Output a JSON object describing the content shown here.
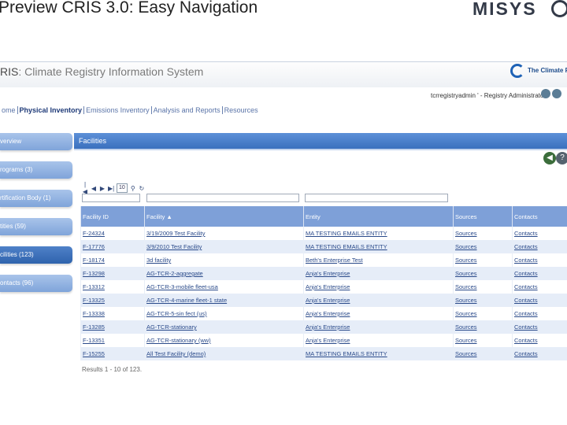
{
  "slide": {
    "title": "Preview CRIS 3.0: Easy Navigation",
    "brand": "MISYS"
  },
  "app": {
    "title_prefix": "RIS",
    "title_rest": ": Climate Registry Information System",
    "org_name": "The Climate Regis",
    "user_line": "tcrregistryadmin ' - Registry Administrator"
  },
  "tabs": [
    {
      "label": "ome"
    },
    {
      "label": "Physical Inventory",
      "active": true
    },
    {
      "label": "Emissions Inventory"
    },
    {
      "label": "Analysis and Reports"
    },
    {
      "label": "Resources"
    }
  ],
  "sidenav": [
    {
      "label": "verview"
    },
    {
      "label": "rograms (3)"
    },
    {
      "label": "rtification Body (1)"
    },
    {
      "label": "tities (59)"
    },
    {
      "label": "cilities (123)",
      "active": true
    },
    {
      "label": "ontacts (96)"
    }
  ],
  "panel": {
    "title": "Facilities"
  },
  "pager": {
    "page_size": "10"
  },
  "grid": {
    "headers": [
      "Facility ID",
      "Facility ▲",
      "Entity",
      "Sources",
      "Contacts"
    ],
    "rows": [
      [
        "F-24324",
        "3/19/2009 Test Facility",
        "MA TESTING EMAILS ENTITY",
        "Sources",
        "Contacts"
      ],
      [
        "F-17776",
        "3/9/2010 Test Facility",
        "MA TESTING EMAILS ENTITY",
        "Sources",
        "Contacts"
      ],
      [
        "F-18174",
        "3d facility",
        "Beth's Enterprise Test",
        "Sources",
        "Contacts"
      ],
      [
        "F-13298",
        "AG-TCR-2-aggregate",
        "Anja's Enterprise",
        "Sources",
        "Contacts"
      ],
      [
        "F-13312",
        "AG-TCR-3-mobile fleet-usa",
        "Anja's Enterprise",
        "Sources",
        "Contacts"
      ],
      [
        "F-13325",
        "AG-TCR-4-marine fleet-1 state",
        "Anja's Enterprise",
        "Sources",
        "Contacts"
      ],
      [
        "F-13338",
        "AG-TCR-5-sin fect (us)",
        "Anja's Enterprise",
        "Sources",
        "Contacts"
      ],
      [
        "F-13285",
        "AG-TCR-stationary",
        "Anja's Enterprise",
        "Sources",
        "Contacts"
      ],
      [
        "F-13351",
        "AG-TCR-stationary (ww)",
        "Anja's Enterprise",
        "Sources",
        "Contacts"
      ],
      [
        "F-15255",
        "All Test Facility (demo)",
        "MA TESTING EMAILS ENTITY",
        "Sources",
        "Contacts"
      ]
    ],
    "results": "Results 1 - 10 of 123."
  }
}
